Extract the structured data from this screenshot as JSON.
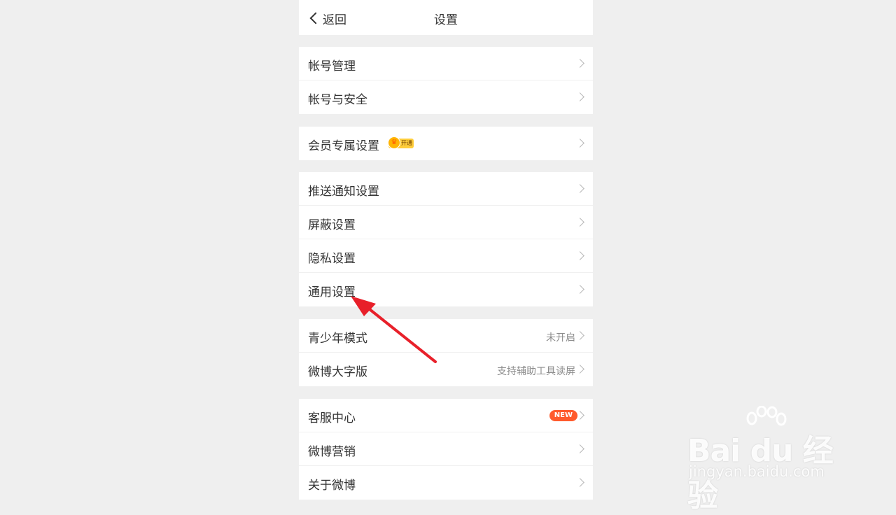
{
  "navbar": {
    "back_label": "返回",
    "title": "设置"
  },
  "groups": [
    {
      "items": [
        {
          "label": "帐号管理"
        },
        {
          "label": "帐号与安全"
        }
      ]
    },
    {
      "items": [
        {
          "label": "会员专属设置",
          "badge": "开通"
        }
      ]
    },
    {
      "items": [
        {
          "label": "推送通知设置"
        },
        {
          "label": "屏蔽设置"
        },
        {
          "label": "隐私设置"
        },
        {
          "label": "通用设置"
        }
      ]
    },
    {
      "items": [
        {
          "label": "青少年模式",
          "value": "未开启"
        },
        {
          "label": "微博大字版",
          "value": "支持辅助工具读屏"
        }
      ]
    },
    {
      "items": [
        {
          "label": "客服中心",
          "badge": "NEW"
        },
        {
          "label": "微博营销"
        },
        {
          "label": "关于微博"
        }
      ]
    }
  ],
  "watermark": {
    "brand": "Bai du 经验",
    "url": "jingyan.baidu.com"
  },
  "colors": {
    "annotation_arrow": "#e8202a",
    "new_badge": "#ff5a2c",
    "vip_badge": "#ffcd3a",
    "background": "#efefef"
  },
  "icons": [
    "back-chevron-icon",
    "chevron-right-icon",
    "crown-icon",
    "baidu-paw-icon"
  ]
}
